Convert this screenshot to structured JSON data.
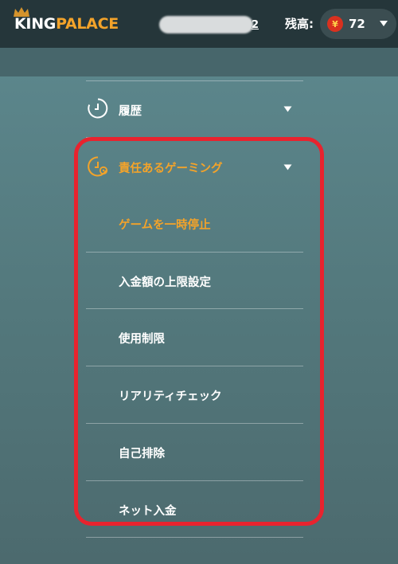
{
  "header": {
    "logo_king": "KING",
    "logo_palace": "PALACE",
    "username_visible_tail": "2",
    "balance_label": "残高:",
    "currency_symbol": "¥",
    "balance_value": "72"
  },
  "menu": {
    "history": {
      "label": "履歴",
      "icon": "clock-icon"
    },
    "responsible_gaming": {
      "label": "責任あるゲーミング",
      "icon": "clock-settings-icon",
      "items": [
        {
          "label": "ゲームを一時停止",
          "active": true
        },
        {
          "label": "入金額の上限設定",
          "active": false
        },
        {
          "label": "使用制限",
          "active": false
        },
        {
          "label": "リアリティチェック",
          "active": false
        },
        {
          "label": "自己排除",
          "active": false
        },
        {
          "label": "ネット入金",
          "active": false
        }
      ]
    }
  },
  "colors": {
    "accent": "#f3a32a",
    "highlight_border": "#e8232e",
    "topbar": "#25363a",
    "background": "#5e8a90"
  }
}
